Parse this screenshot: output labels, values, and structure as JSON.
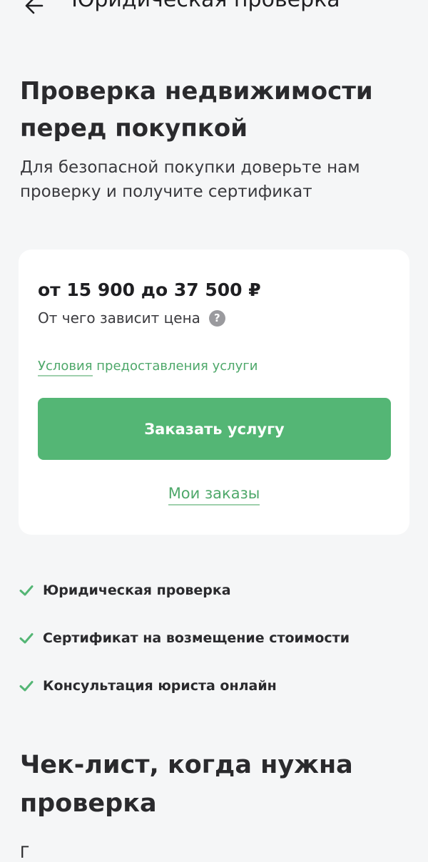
{
  "header": {
    "back_icon": "arrow-left-icon",
    "title": "Юридическая проверка"
  },
  "hero": {
    "title": "Проверка недвижимости перед покупкой",
    "subtitle": "Для безопасной покупки доверьте нам проверку и получите сертификат"
  },
  "pricing_card": {
    "price": "от 15 900 до 37 500 ₽",
    "price_hint": "От чего зависит цена",
    "help_icon": "question-circle-icon",
    "help_glyph": "?",
    "terms_link_part1": "Условия",
    "terms_link_part2": " предоставления услуги",
    "order_button": "Заказать услугу",
    "my_orders_link": "Мои заказы"
  },
  "features": [
    {
      "icon": "check-icon",
      "label": "Юридическая проверка"
    },
    {
      "icon": "check-icon",
      "label": "Сертификат на возмещение стоимости"
    },
    {
      "icon": "check-icon",
      "label": "Консультация юриста онлайн"
    }
  ],
  "checklist": {
    "title": "Чек-лист, когда нужна проверка",
    "text": "Г"
  },
  "colors": {
    "accent": "#54b675",
    "link": "#4ea86a",
    "background": "#f5f6f7",
    "card": "#ffffff"
  }
}
